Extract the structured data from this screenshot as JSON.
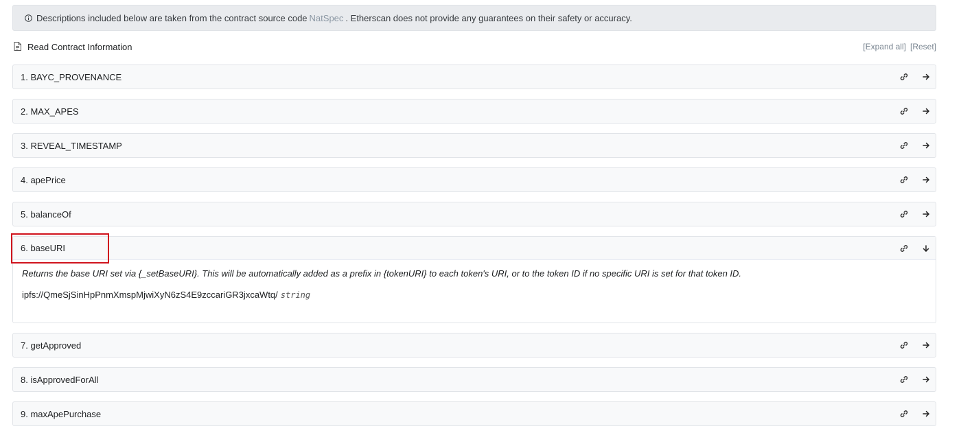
{
  "notice": {
    "text_before": "Descriptions included below are taken from the contract source code",
    "link": "NatSpec",
    "text_after": ". Etherscan does not provide any guarantees on their safety or accuracy."
  },
  "header": {
    "title": "Read Contract Information",
    "expand_all": "[Expand all]",
    "reset": "[Reset]"
  },
  "functions": [
    {
      "label": "1. BAYC_PROVENANCE"
    },
    {
      "label": "2. MAX_APES"
    },
    {
      "label": "3. REVEAL_TIMESTAMP"
    },
    {
      "label": "4. apePrice"
    },
    {
      "label": "5. balanceOf"
    },
    {
      "label": "6. baseURI",
      "description": "Returns the base URI set via {_setBaseURI}. This will be automatically added as a prefix in {tokenURI} to each token's URI, or to the token ID if no specific URI is set for that token ID.",
      "result_value": "ipfs://QmeSjSinHpPnmXmspMjwiXyN6zS4E9zccariGR3jxcaWtq/",
      "result_type": "string"
    },
    {
      "label": "7. getApproved"
    },
    {
      "label": "8. isApprovedForAll"
    },
    {
      "label": "9. maxApePurchase"
    }
  ],
  "colors": {
    "highlight": "#d0131d"
  }
}
